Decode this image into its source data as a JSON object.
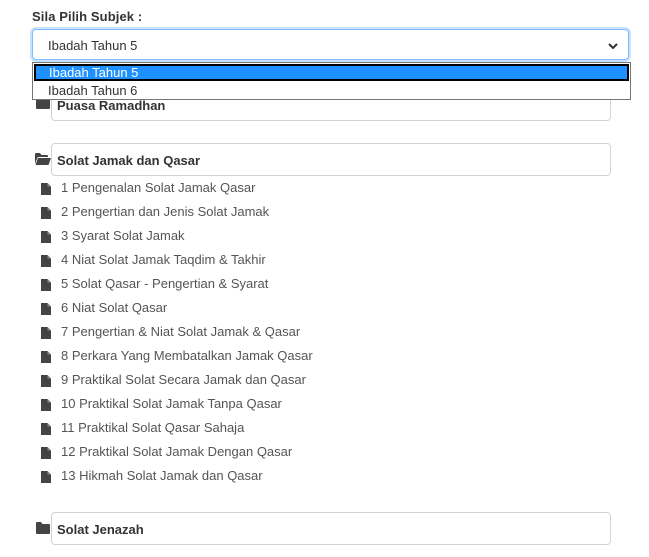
{
  "subject": {
    "label": "Sila Pilih Subjek :",
    "selected": "Ibadah Tahun 5",
    "options": [
      "Ibadah Tahun 5",
      "Ibadah Tahun 6"
    ]
  },
  "groups": [
    {
      "title": "Puasa Ramadhan",
      "expanded": false
    },
    {
      "title": "Solat Jamak dan Qasar",
      "expanded": true
    },
    {
      "title": "Solat Jenazah",
      "expanded": false
    }
  ],
  "lessons": [
    "1 Pengenalan Solat Jamak Qasar",
    "2 Pengertian dan Jenis Solat Jamak",
    "3 Syarat Solat Jamak",
    "4 Niat Solat Jamak Taqdim & Takhir",
    "5 Solat Qasar - Pengertian & Syarat",
    "6 Niat Solat Qasar",
    "7 Pengertian & Niat Solat Jamak & Qasar",
    "8 Perkara Yang Membatalkan Jamak Qasar",
    "9 Praktikal Solat Secara Jamak dan Qasar",
    "10 Praktikal Solat Jamak Tanpa Qasar",
    "11 Praktikal Solat Qasar Sahaja",
    "12 Praktikal Solat Jamak Dengan Qasar",
    "13 Hikmah Solat Jamak dan Qasar"
  ],
  "colors": {
    "focus_border": "#80bdff",
    "option_highlight": "#1e90ff",
    "icon": "#444444",
    "text": "#333333"
  }
}
